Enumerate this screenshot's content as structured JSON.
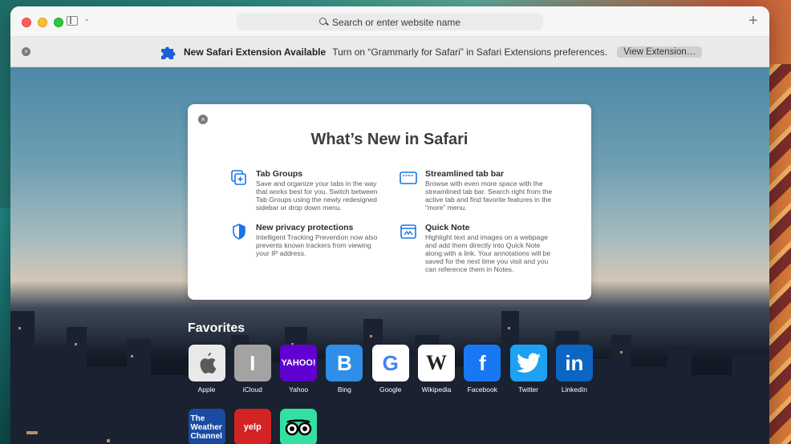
{
  "window": {
    "address_placeholder": "Search or enter website name"
  },
  "extension_bar": {
    "title": "New Safari Extension Available",
    "message": "Turn on “Grammarly for Safari” in Safari Extensions preferences.",
    "button": "View Extension…"
  },
  "whats_new": {
    "title": "What’s New in Safari",
    "features": [
      {
        "title": "Tab Groups",
        "description": "Save and organize your tabs in the way that works best for you. Switch between Tab Groups using the newly redesigned sidebar or drop down menu.",
        "icon": "tab-groups-icon"
      },
      {
        "title": "Streamlined tab bar",
        "description": "Browse with even more space with the streamlined tab bar. Search right from the active tab and find favorite features in the “more” menu.",
        "icon": "tab-bar-icon"
      },
      {
        "title": "New privacy protections",
        "description": "Intelligent Tracking Prevention now also prevents known trackers from viewing your IP address.",
        "icon": "shield-icon"
      },
      {
        "title": "Quick Note",
        "description": "Highlight text and images on a webpage and add them directly into Quick Note along with a link. Your annotations will be saved for the next time you visit and you can reference them in Notes.",
        "icon": "quick-note-icon"
      }
    ]
  },
  "favorites": {
    "title": "Favorites",
    "items": [
      {
        "label": "Apple",
        "tile_text": "",
        "bg": "#e9e9e9",
        "fg": "#555555"
      },
      {
        "label": "iCloud",
        "tile_text": "I",
        "bg": "#a3a3a3",
        "fg": "#ffffff"
      },
      {
        "label": "Yahoo",
        "tile_text": "YAHOO!",
        "bg": "#6001d2",
        "fg": "#ffffff"
      },
      {
        "label": "Bing",
        "tile_text": "B",
        "bg": "#2f8fe8",
        "fg": "#ffffff"
      },
      {
        "label": "Google",
        "tile_text": "G",
        "bg": "#ffffff",
        "fg": "#4285f4"
      },
      {
        "label": "Wikipedia",
        "tile_text": "W",
        "bg": "#ffffff",
        "fg": "#222222"
      },
      {
        "label": "Facebook",
        "tile_text": "f",
        "bg": "#1877f2",
        "fg": "#ffffff"
      },
      {
        "label": "Twitter",
        "tile_text": "",
        "bg": "#1da1f2",
        "fg": "#ffffff"
      },
      {
        "label": "LinkedIn",
        "tile_text": "in",
        "bg": "#0a66c2",
        "fg": "#ffffff"
      },
      {
        "label": "",
        "tile_text": "The Weather Channel",
        "bg": "#1b4aa3",
        "fg": "#ffffff"
      },
      {
        "label": "",
        "tile_text": "yelp",
        "bg": "#d32323",
        "fg": "#ffffff"
      },
      {
        "label": "",
        "tile_text": "",
        "bg": "#34e0a1",
        "fg": "#000000"
      }
    ]
  }
}
